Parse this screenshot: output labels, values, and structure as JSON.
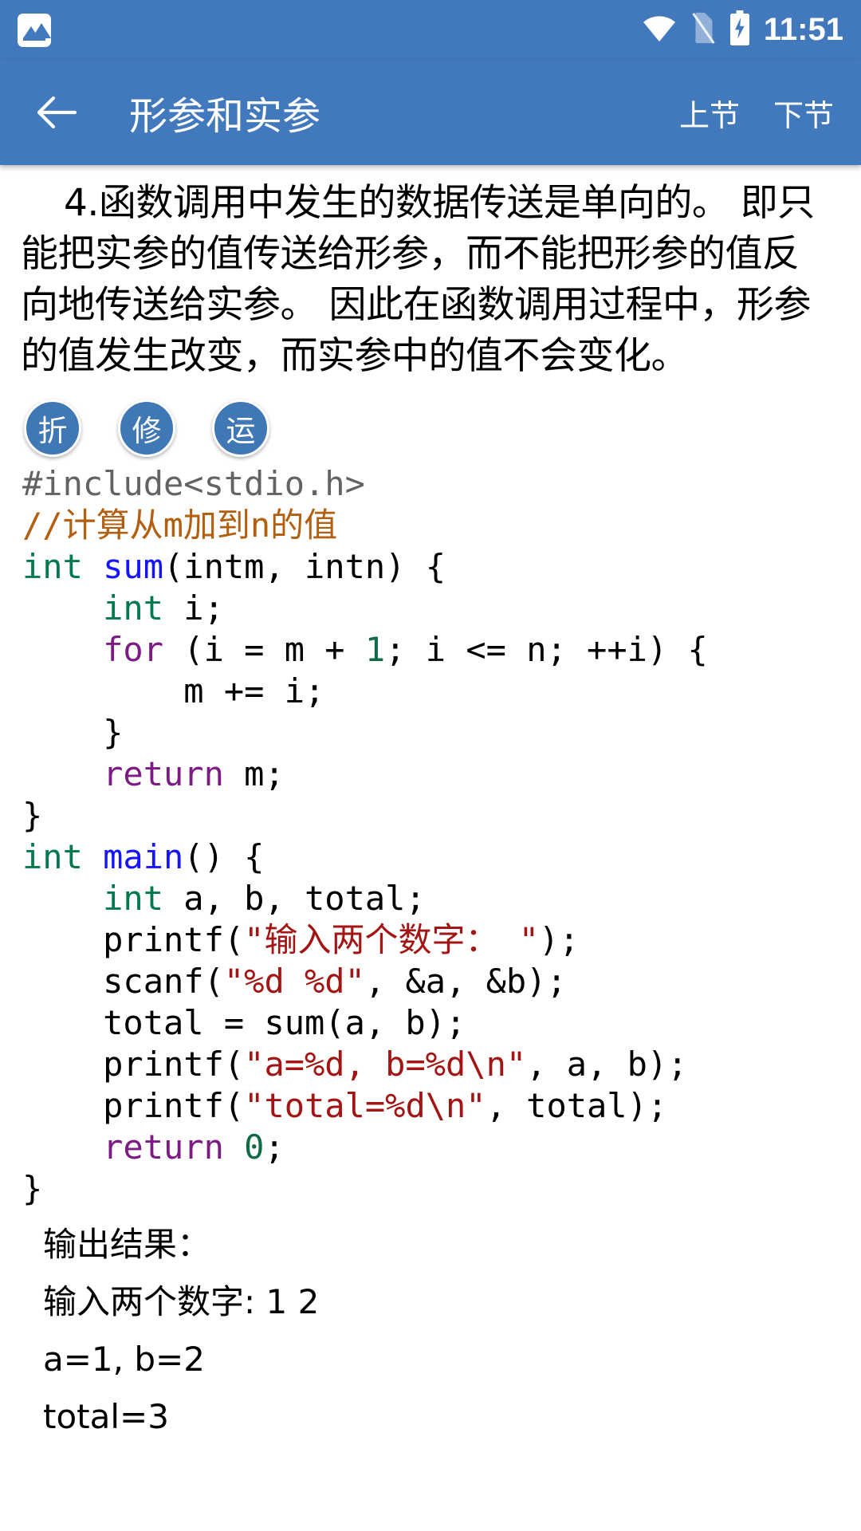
{
  "status_bar": {
    "notification_icon": "image-icon",
    "wifi_icon": "wifi-icon",
    "sim_icon": "no-sim-icon",
    "battery_icon": "battery-charging-icon",
    "time": "11:51"
  },
  "app_bar": {
    "back_icon": "arrow-left-icon",
    "title": "形参和实参",
    "prev_label": "上节",
    "next_label": "下节"
  },
  "body": {
    "paragraph": "4.函数调用中发生的数据传送是单向的。 即只能把实参的值传送给形参，而不能把形参的值反向地传送给实参。 因此在函数调用过程中，形参的值发生改变，而实参中的值不会变化。"
  },
  "chips": [
    {
      "label": "折",
      "name": "chip-fold"
    },
    {
      "label": "修",
      "name": "chip-edit"
    },
    {
      "label": "运",
      "name": "chip-run"
    }
  ],
  "code": {
    "l01_pp": "#include<stdio.h>",
    "l02_cm": "//计算从m加到n的值",
    "l03_kw": "int",
    "l03_fn": " sum",
    "l03_rest": "(intm, intn) {",
    "l04_kw": "    int",
    "l04_rest": " i;",
    "l05_kw": "    for",
    "l05_a": " (i = m + ",
    "l05_num": "1",
    "l05_b": "; i <= n; ++i) {",
    "l06": "        m += i;",
    "l07": "    }",
    "l08_kw": "    return",
    "l08_rest": " m;",
    "l09": "}",
    "l10_kw": "int",
    "l10_fn": " main",
    "l10_rest": "() {",
    "l11_kw": "    int",
    "l11_rest": " a, b, total;",
    "l12_a": "    printf(",
    "l12_str": "\"输入两个数字： \"",
    "l12_b": ");",
    "l13_a": "    scanf(",
    "l13_str": "\"%d %d\"",
    "l13_b": ", &a, &b);",
    "l14": "    total = sum(a, b);",
    "l15_a": "    printf(",
    "l15_str": "\"a=%d, b=%d\\n\"",
    "l15_b": ", a, b);",
    "l16_a": "    printf(",
    "l16_str": "\"total=%d\\n\"",
    "l16_b": ", total);",
    "l17_kw": "    return",
    "l17_num": " 0",
    "l17_rest": ";",
    "l18": "}"
  },
  "output": {
    "heading": "输出结果：",
    "line1": "输入两个数字: 1 2",
    "line2": "a=1, b=2",
    "line3": "total=3"
  },
  "colors": {
    "brand_blue": "#4279bd",
    "chip_blue": "#3f78b5",
    "comment": "#b35f10",
    "keyword_type": "#007a4d",
    "keyword_ctrl": "#7d1b85",
    "function": "#1414ff",
    "string": "#a31515",
    "preprocessor": "#636363"
  }
}
